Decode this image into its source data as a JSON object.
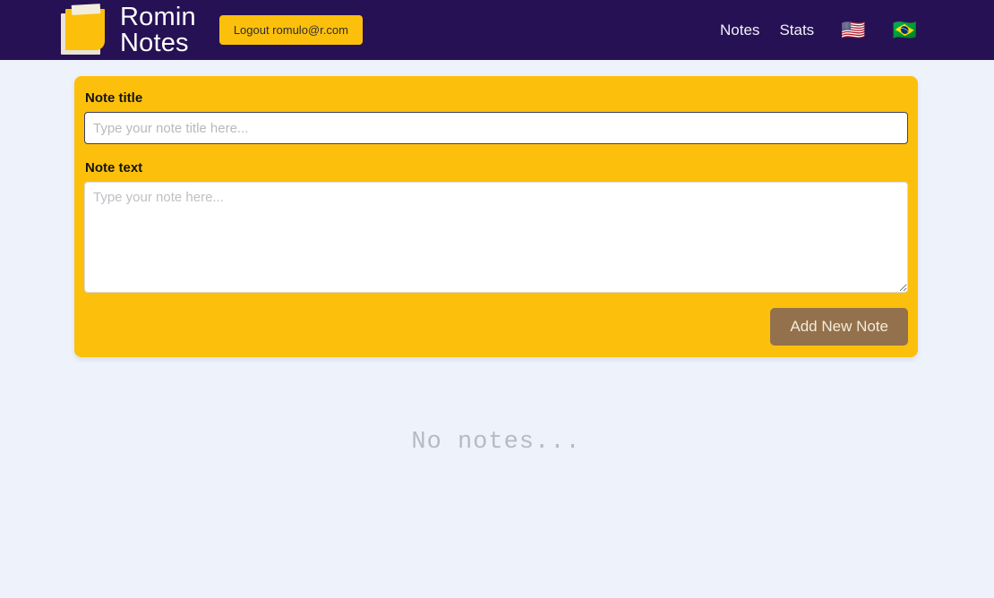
{
  "header": {
    "brand": {
      "line1": "Romin",
      "line2": "Notes",
      "icon": "sticky-note-icon"
    },
    "logout_label": "Logout romulo@r.com",
    "nav": [
      {
        "label": "Notes",
        "name": "nav-link-notes"
      },
      {
        "label": "Stats",
        "name": "nav-link-stats"
      }
    ],
    "flags": [
      {
        "glyph": "🇺🇸",
        "name": "flag-us-icon"
      },
      {
        "glyph": "🇧🇷",
        "name": "flag-br-icon"
      }
    ],
    "background_color": "#271155"
  },
  "form": {
    "title_label": "Note title",
    "title_value": "",
    "title_placeholder": "Type your note title here...",
    "text_label": "Note text",
    "text_value": "",
    "text_placeholder": "Type your note here...",
    "submit_label": "Add New Note",
    "card_color": "#fcc00c",
    "submit_color": "#93714c"
  },
  "notes_list": {
    "empty_message": "No notes..."
  },
  "page": {
    "background_color": "#eef2fb"
  }
}
